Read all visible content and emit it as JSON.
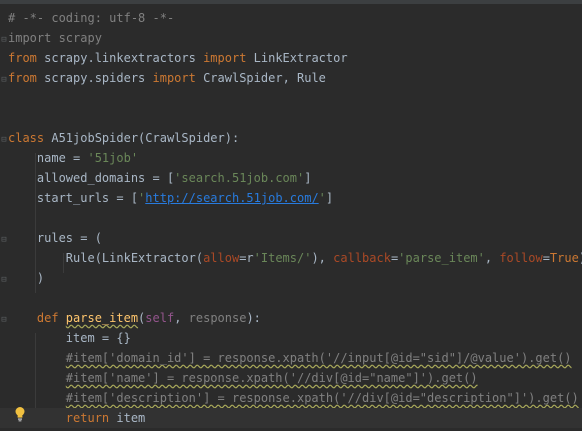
{
  "lines": [
    {
      "tokens": [
        {
          "t": "# -*- coding: utf-8 -*-",
          "c": "t-comment"
        }
      ]
    },
    {
      "tokens": [
        {
          "t": "import scrapy",
          "c": "t-dim"
        }
      ]
    },
    {
      "tokens": [
        {
          "t": "from ",
          "c": "t-kw"
        },
        {
          "t": "scrapy.linkextractors ",
          "c": ""
        },
        {
          "t": "import ",
          "c": "t-kw"
        },
        {
          "t": "LinkExtractor",
          "c": ""
        }
      ]
    },
    {
      "tokens": [
        {
          "t": "from ",
          "c": "t-kw"
        },
        {
          "t": "scrapy.spiders ",
          "c": ""
        },
        {
          "t": "import ",
          "c": "t-kw"
        },
        {
          "t": "CrawlSpider",
          "c": ""
        },
        {
          "t": ", Rule",
          "c": ""
        }
      ]
    },
    {
      "tokens": []
    },
    {
      "tokens": []
    },
    {
      "tokens": [
        {
          "t": "class ",
          "c": "t-kw"
        },
        {
          "t": "A51jobSpider(CrawlSpider):",
          "c": ""
        }
      ]
    },
    {
      "tokens": [
        {
          "t": "    name = ",
          "c": ""
        },
        {
          "t": "'51job'",
          "c": "t-str"
        }
      ]
    },
    {
      "tokens": [
        {
          "t": "    allowed_domains = [",
          "c": ""
        },
        {
          "t": "'search.51job.com'",
          "c": "t-str"
        },
        {
          "t": "]",
          "c": ""
        }
      ]
    },
    {
      "tokens": [
        {
          "t": "    start_urls = [",
          "c": ""
        },
        {
          "t": "'",
          "c": "t-str"
        },
        {
          "t": "http://search.51job.com/",
          "c": "t-link"
        },
        {
          "t": "'",
          "c": "t-str"
        },
        {
          "t": "]",
          "c": ""
        }
      ]
    },
    {
      "tokens": []
    },
    {
      "tokens": [
        {
          "t": "    rules = (",
          "c": ""
        }
      ]
    },
    {
      "tokens": [
        {
          "t": "        Rule(LinkExtractor(",
          "c": ""
        },
        {
          "t": "allow",
          "c": "t-param"
        },
        {
          "t": "=r",
          "c": ""
        },
        {
          "t": "'Items/'",
          "c": "t-str"
        },
        {
          "t": "), ",
          "c": ""
        },
        {
          "t": "callback",
          "c": "t-param"
        },
        {
          "t": "=",
          "c": ""
        },
        {
          "t": "'parse_item'",
          "c": "t-str"
        },
        {
          "t": ", ",
          "c": ""
        },
        {
          "t": "follow",
          "c": "t-param"
        },
        {
          "t": "=",
          "c": ""
        },
        {
          "t": "True",
          "c": "t-kw"
        },
        {
          "t": "),",
          "c": ""
        }
      ]
    },
    {
      "tokens": [
        {
          "t": "    )",
          "c": ""
        }
      ]
    },
    {
      "tokens": []
    },
    {
      "tokens": [
        {
          "t": "    def ",
          "c": "t-kw"
        },
        {
          "t": "parse_item",
          "c": "t-func squiggle"
        },
        {
          "t": "(",
          "c": ""
        },
        {
          "t": "self",
          "c": "t-self"
        },
        {
          "t": ", ",
          "c": ""
        },
        {
          "t": "response",
          "c": "t-dim"
        },
        {
          "t": "):",
          "c": ""
        }
      ]
    },
    {
      "tokens": [
        {
          "t": "        item = {}",
          "c": ""
        }
      ]
    },
    {
      "tokens": [
        {
          "t": "        ",
          "c": ""
        },
        {
          "t": "#item['domain_id'] = response.xpath('//input[@id=\"sid\"]/@value').get()",
          "c": "t-comment squiggle"
        }
      ]
    },
    {
      "tokens": [
        {
          "t": "        ",
          "c": ""
        },
        {
          "t": "#item['name'] = response.xpath('//div[@id=\"name\"]').get()",
          "c": "t-comment squiggle"
        }
      ]
    },
    {
      "tokens": [
        {
          "t": "        ",
          "c": ""
        },
        {
          "t": "#item['description'] = response.xpath('//div[@id=\"description\"]').get()",
          "c": "t-comment squiggle"
        }
      ]
    },
    {
      "tokens": [
        {
          "t": "        ",
          "c": ""
        },
        {
          "t": "return ",
          "c": "t-kw"
        },
        {
          "t": "item",
          "c": ""
        }
      ]
    }
  ]
}
